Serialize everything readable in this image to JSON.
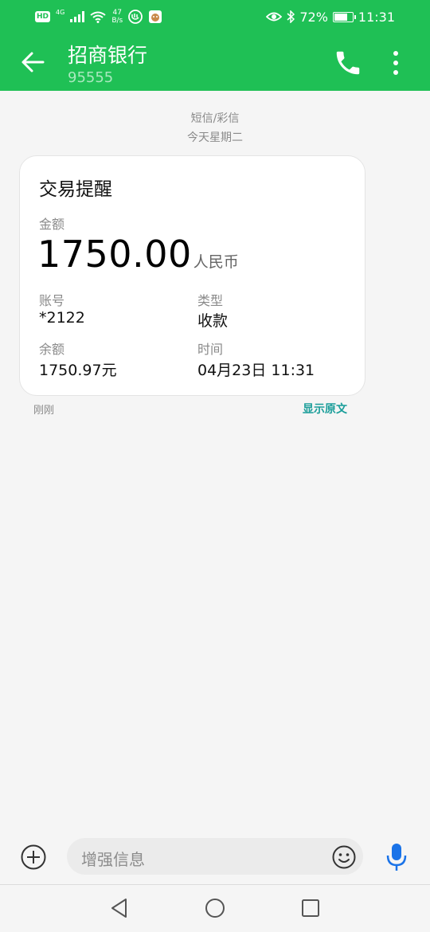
{
  "status_bar": {
    "hd": "HD",
    "network": "4G",
    "speed_value": "47",
    "speed_unit": "B/s",
    "battery": "72%",
    "battery_level": 0.72,
    "time": "11:31"
  },
  "header": {
    "contact_name": "招商银行",
    "contact_number": "95555"
  },
  "messages": {
    "type_label": "短信/彩信",
    "date_label": "今天星期二",
    "card": {
      "title": "交易提醒",
      "amount_label": "金额",
      "amount_value": "1750.00",
      "amount_unit": "人民币",
      "account_label": "账号",
      "account_value": "*2122",
      "type_label": "类型",
      "type_value": "收款",
      "balance_label": "余额",
      "balance_value": "1750.97元",
      "time_label": "时间",
      "time_value": "04月23日 11:31"
    },
    "sent_time": "刚刚",
    "show_original": "显示原文"
  },
  "compose": {
    "placeholder": "增强信息"
  },
  "colors": {
    "accent": "#1fc055",
    "link": "#1a9e9a",
    "mic": "#1a73e8"
  }
}
